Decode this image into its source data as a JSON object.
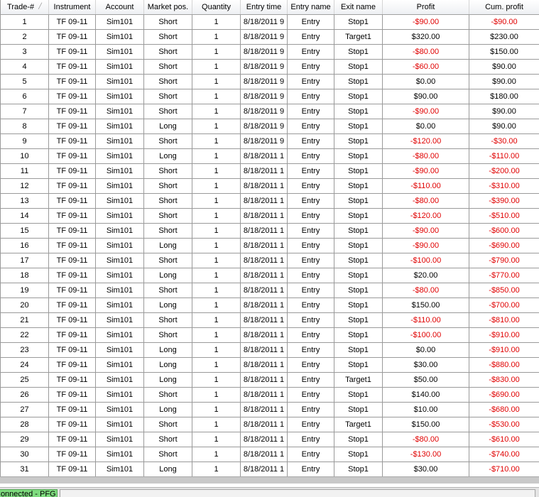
{
  "columns": [
    "Trade-#",
    "Instrument",
    "Account",
    "Market pos.",
    "Quantity",
    "Entry time",
    "Entry name",
    "Exit name",
    "Profit",
    "Cum. profit"
  ],
  "sort_icon": "sort-arrow-icon",
  "colors": {
    "negative": "#e00000",
    "positive": "#000000",
    "connected": "#7fdc7f"
  },
  "rows": [
    {
      "trade": "1",
      "instrument": "TF 09-11",
      "account": "Sim101",
      "position": "Short",
      "quantity": "1",
      "entry_time": "8/18/2011 9",
      "entry_name": "Entry",
      "exit_name": "Stop1",
      "profit": "-$90.00",
      "cum_profit": "-$90.00"
    },
    {
      "trade": "2",
      "instrument": "TF 09-11",
      "account": "Sim101",
      "position": "Short",
      "quantity": "1",
      "entry_time": "8/18/2011 9",
      "entry_name": "Entry",
      "exit_name": "Target1",
      "profit": "$320.00",
      "cum_profit": "$230.00"
    },
    {
      "trade": "3",
      "instrument": "TF 09-11",
      "account": "Sim101",
      "position": "Short",
      "quantity": "1",
      "entry_time": "8/18/2011 9",
      "entry_name": "Entry",
      "exit_name": "Stop1",
      "profit": "-$80.00",
      "cum_profit": "$150.00"
    },
    {
      "trade": "4",
      "instrument": "TF 09-11",
      "account": "Sim101",
      "position": "Short",
      "quantity": "1",
      "entry_time": "8/18/2011 9",
      "entry_name": "Entry",
      "exit_name": "Stop1",
      "profit": "-$60.00",
      "cum_profit": "$90.00"
    },
    {
      "trade": "5",
      "instrument": "TF 09-11",
      "account": "Sim101",
      "position": "Short",
      "quantity": "1",
      "entry_time": "8/18/2011 9",
      "entry_name": "Entry",
      "exit_name": "Stop1",
      "profit": "$0.00",
      "cum_profit": "$90.00"
    },
    {
      "trade": "6",
      "instrument": "TF 09-11",
      "account": "Sim101",
      "position": "Short",
      "quantity": "1",
      "entry_time": "8/18/2011 9",
      "entry_name": "Entry",
      "exit_name": "Stop1",
      "profit": "$90.00",
      "cum_profit": "$180.00"
    },
    {
      "trade": "7",
      "instrument": "TF 09-11",
      "account": "Sim101",
      "position": "Short",
      "quantity": "1",
      "entry_time": "8/18/2011 9",
      "entry_name": "Entry",
      "exit_name": "Stop1",
      "profit": "-$90.00",
      "cum_profit": "$90.00"
    },
    {
      "trade": "8",
      "instrument": "TF 09-11",
      "account": "Sim101",
      "position": "Long",
      "quantity": "1",
      "entry_time": "8/18/2011 9",
      "entry_name": "Entry",
      "exit_name": "Stop1",
      "profit": "$0.00",
      "cum_profit": "$90.00"
    },
    {
      "trade": "9",
      "instrument": "TF 09-11",
      "account": "Sim101",
      "position": "Short",
      "quantity": "1",
      "entry_time": "8/18/2011 9",
      "entry_name": "Entry",
      "exit_name": "Stop1",
      "profit": "-$120.00",
      "cum_profit": "-$30.00"
    },
    {
      "trade": "10",
      "instrument": "TF 09-11",
      "account": "Sim101",
      "position": "Long",
      "quantity": "1",
      "entry_time": "8/18/2011 1",
      "entry_name": "Entry",
      "exit_name": "Stop1",
      "profit": "-$80.00",
      "cum_profit": "-$110.00"
    },
    {
      "trade": "11",
      "instrument": "TF 09-11",
      "account": "Sim101",
      "position": "Short",
      "quantity": "1",
      "entry_time": "8/18/2011 1",
      "entry_name": "Entry",
      "exit_name": "Stop1",
      "profit": "-$90.00",
      "cum_profit": "-$200.00"
    },
    {
      "trade": "12",
      "instrument": "TF 09-11",
      "account": "Sim101",
      "position": "Short",
      "quantity": "1",
      "entry_time": "8/18/2011 1",
      "entry_name": "Entry",
      "exit_name": "Stop1",
      "profit": "-$110.00",
      "cum_profit": "-$310.00"
    },
    {
      "trade": "13",
      "instrument": "TF 09-11",
      "account": "Sim101",
      "position": "Short",
      "quantity": "1",
      "entry_time": "8/18/2011 1",
      "entry_name": "Entry",
      "exit_name": "Stop1",
      "profit": "-$80.00",
      "cum_profit": "-$390.00"
    },
    {
      "trade": "14",
      "instrument": "TF 09-11",
      "account": "Sim101",
      "position": "Short",
      "quantity": "1",
      "entry_time": "8/18/2011 1",
      "entry_name": "Entry",
      "exit_name": "Stop1",
      "profit": "-$120.00",
      "cum_profit": "-$510.00"
    },
    {
      "trade": "15",
      "instrument": "TF 09-11",
      "account": "Sim101",
      "position": "Short",
      "quantity": "1",
      "entry_time": "8/18/2011 1",
      "entry_name": "Entry",
      "exit_name": "Stop1",
      "profit": "-$90.00",
      "cum_profit": "-$600.00"
    },
    {
      "trade": "16",
      "instrument": "TF 09-11",
      "account": "Sim101",
      "position": "Long",
      "quantity": "1",
      "entry_time": "8/18/2011 1",
      "entry_name": "Entry",
      "exit_name": "Stop1",
      "profit": "-$90.00",
      "cum_profit": "-$690.00"
    },
    {
      "trade": "17",
      "instrument": "TF 09-11",
      "account": "Sim101",
      "position": "Short",
      "quantity": "1",
      "entry_time": "8/18/2011 1",
      "entry_name": "Entry",
      "exit_name": "Stop1",
      "profit": "-$100.00",
      "cum_profit": "-$790.00"
    },
    {
      "trade": "18",
      "instrument": "TF 09-11",
      "account": "Sim101",
      "position": "Long",
      "quantity": "1",
      "entry_time": "8/18/2011 1",
      "entry_name": "Entry",
      "exit_name": "Stop1",
      "profit": "$20.00",
      "cum_profit": "-$770.00"
    },
    {
      "trade": "19",
      "instrument": "TF 09-11",
      "account": "Sim101",
      "position": "Short",
      "quantity": "1",
      "entry_time": "8/18/2011 1",
      "entry_name": "Entry",
      "exit_name": "Stop1",
      "profit": "-$80.00",
      "cum_profit": "-$850.00"
    },
    {
      "trade": "20",
      "instrument": "TF 09-11",
      "account": "Sim101",
      "position": "Long",
      "quantity": "1",
      "entry_time": "8/18/2011 1",
      "entry_name": "Entry",
      "exit_name": "Stop1",
      "profit": "$150.00",
      "cum_profit": "-$700.00"
    },
    {
      "trade": "21",
      "instrument": "TF 09-11",
      "account": "Sim101",
      "position": "Short",
      "quantity": "1",
      "entry_time": "8/18/2011 1",
      "entry_name": "Entry",
      "exit_name": "Stop1",
      "profit": "-$110.00",
      "cum_profit": "-$810.00"
    },
    {
      "trade": "22",
      "instrument": "TF 09-11",
      "account": "Sim101",
      "position": "Short",
      "quantity": "1",
      "entry_time": "8/18/2011 1",
      "entry_name": "Entry",
      "exit_name": "Stop1",
      "profit": "-$100.00",
      "cum_profit": "-$910.00"
    },
    {
      "trade": "23",
      "instrument": "TF 09-11",
      "account": "Sim101",
      "position": "Long",
      "quantity": "1",
      "entry_time": "8/18/2011 1",
      "entry_name": "Entry",
      "exit_name": "Stop1",
      "profit": "$0.00",
      "cum_profit": "-$910.00"
    },
    {
      "trade": "24",
      "instrument": "TF 09-11",
      "account": "Sim101",
      "position": "Long",
      "quantity": "1",
      "entry_time": "8/18/2011 1",
      "entry_name": "Entry",
      "exit_name": "Stop1",
      "profit": "$30.00",
      "cum_profit": "-$880.00"
    },
    {
      "trade": "25",
      "instrument": "TF 09-11",
      "account": "Sim101",
      "position": "Long",
      "quantity": "1",
      "entry_time": "8/18/2011 1",
      "entry_name": "Entry",
      "exit_name": "Target1",
      "profit": "$50.00",
      "cum_profit": "-$830.00"
    },
    {
      "trade": "26",
      "instrument": "TF 09-11",
      "account": "Sim101",
      "position": "Short",
      "quantity": "1",
      "entry_time": "8/18/2011 1",
      "entry_name": "Entry",
      "exit_name": "Stop1",
      "profit": "$140.00",
      "cum_profit": "-$690.00"
    },
    {
      "trade": "27",
      "instrument": "TF 09-11",
      "account": "Sim101",
      "position": "Long",
      "quantity": "1",
      "entry_time": "8/18/2011 1",
      "entry_name": "Entry",
      "exit_name": "Stop1",
      "profit": "$10.00",
      "cum_profit": "-$680.00"
    },
    {
      "trade": "28",
      "instrument": "TF 09-11",
      "account": "Sim101",
      "position": "Short",
      "quantity": "1",
      "entry_time": "8/18/2011 1",
      "entry_name": "Entry",
      "exit_name": "Target1",
      "profit": "$150.00",
      "cum_profit": "-$530.00"
    },
    {
      "trade": "29",
      "instrument": "TF 09-11",
      "account": "Sim101",
      "position": "Short",
      "quantity": "1",
      "entry_time": "8/18/2011 1",
      "entry_name": "Entry",
      "exit_name": "Stop1",
      "profit": "-$80.00",
      "cum_profit": "-$610.00"
    },
    {
      "trade": "30",
      "instrument": "TF 09-11",
      "account": "Sim101",
      "position": "Short",
      "quantity": "1",
      "entry_time": "8/18/2011 1",
      "entry_name": "Entry",
      "exit_name": "Stop1",
      "profit": "-$130.00",
      "cum_profit": "-$740.00"
    },
    {
      "trade": "31",
      "instrument": "TF 09-11",
      "account": "Sim101",
      "position": "Long",
      "quantity": "1",
      "entry_time": "8/18/2011 1",
      "entry_name": "Entry",
      "exit_name": "Stop1",
      "profit": "$30.00",
      "cum_profit": "-$710.00"
    }
  ],
  "status": {
    "connection": "Connected - PFG"
  }
}
